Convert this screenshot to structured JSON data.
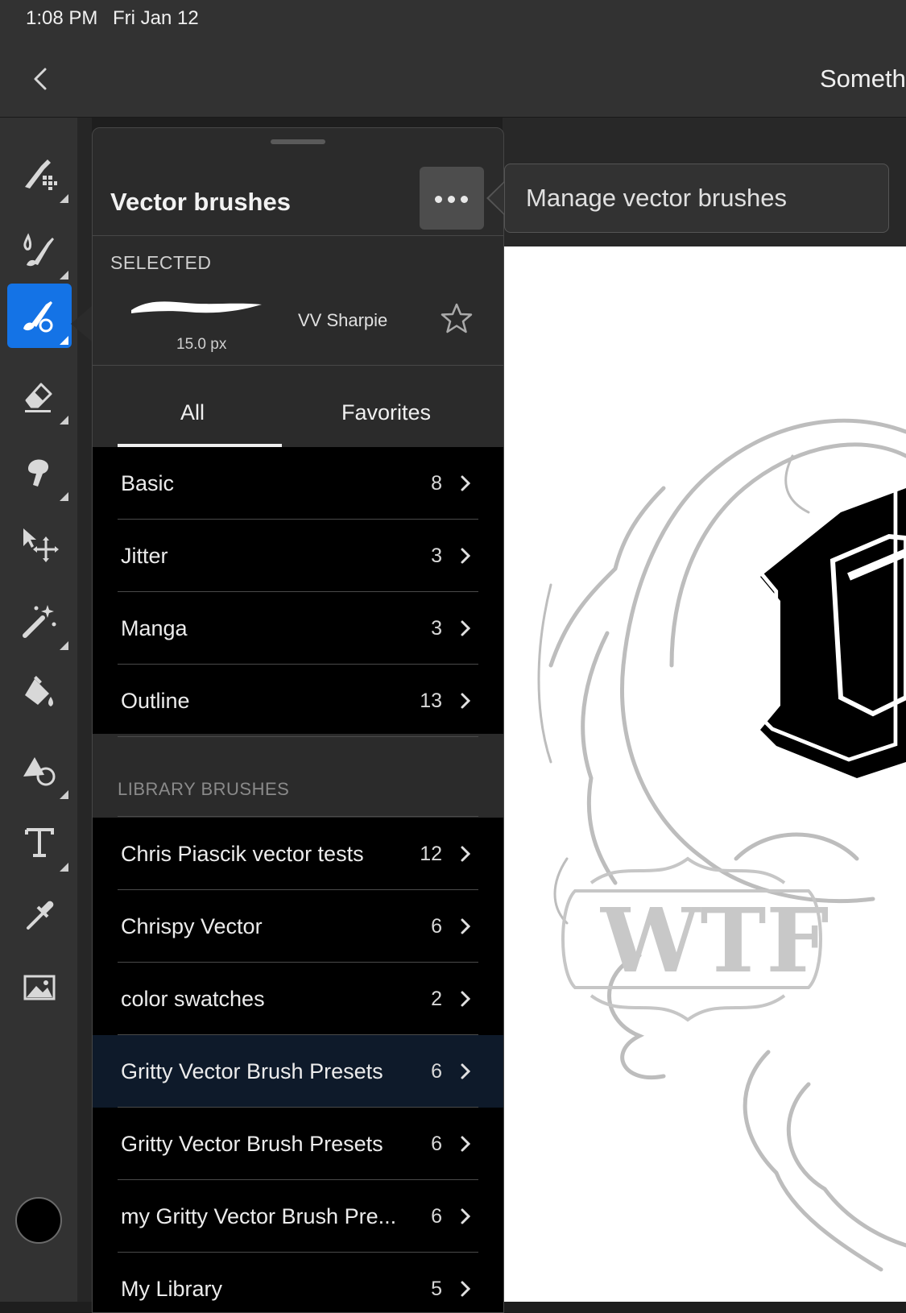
{
  "status_bar": {
    "time": "1:08 PM",
    "date": "Fri Jan 12"
  },
  "header": {
    "title": "Someth"
  },
  "toolbar": {
    "tools": [
      "pixel-brush-icon",
      "paint-brush-icon",
      "vector-brush-icon",
      "eraser-icon",
      "smudge-icon",
      "transform-icon",
      "magic-wand-icon",
      "fill-icon",
      "shape-icon",
      "text-icon",
      "eyedropper-icon",
      "image-icon"
    ],
    "active_tool": "vector-brush-icon",
    "current_color": "#000000",
    "accent": "#1473e6"
  },
  "panel": {
    "title": "Vector brushes",
    "selected_label": "SELECTED",
    "selected_brush": {
      "name": "VV Sharpie",
      "size": "15.0 px"
    },
    "tabs": [
      {
        "label": "All",
        "active": true
      },
      {
        "label": "Favorites",
        "active": false
      }
    ],
    "categories": [
      {
        "label": "Basic",
        "count": "8"
      },
      {
        "label": "Jitter",
        "count": "3"
      },
      {
        "label": "Manga",
        "count": "3"
      },
      {
        "label": "Outline",
        "count": "13"
      }
    ],
    "library_label": "LIBRARY BRUSHES",
    "libraries": [
      {
        "label": "Chris Piascik vector tests",
        "count": "12"
      },
      {
        "label": "Chrispy Vector",
        "count": "6"
      },
      {
        "label": "color swatches",
        "count": "2"
      },
      {
        "label": "Gritty Vector Brush Presets",
        "count": "6",
        "highlighted": true
      },
      {
        "label": "Gritty Vector Brush Presets",
        "count": "6"
      },
      {
        "label": "my Gritty Vector Brush Pre...",
        "count": "6"
      },
      {
        "label": "My Library",
        "count": "5"
      }
    ]
  },
  "tooltip": {
    "text": "Manage vector brushes"
  }
}
